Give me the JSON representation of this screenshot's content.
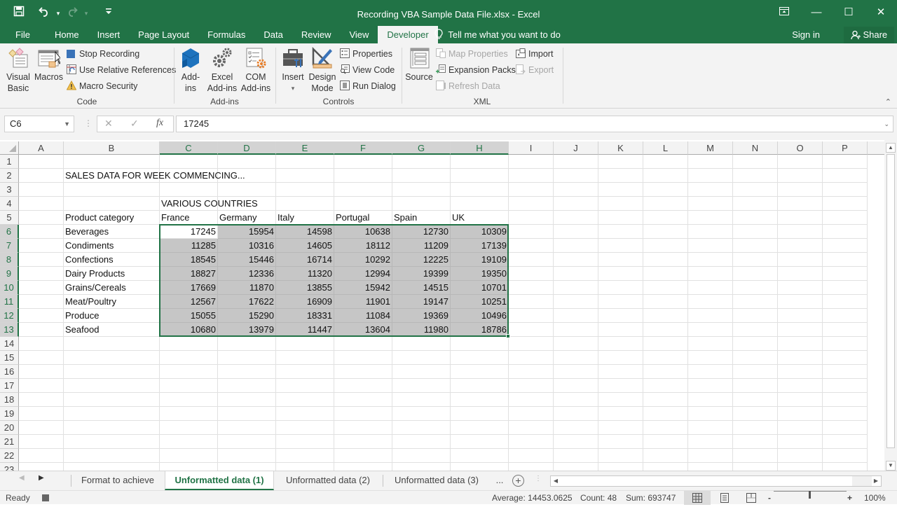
{
  "window": {
    "title": "Recording VBA Sample Data File.xlsx - Excel",
    "controls": {
      "ribbon_display": "⧉",
      "minimize": "—",
      "maximize": "☐",
      "close": "✕"
    }
  },
  "qat": {
    "save": "🖫",
    "undo": "↶",
    "undo_dd": "▾",
    "redo": "↷",
    "redo_dd": "▾",
    "customize": "⩡"
  },
  "ribbon_tabs": [
    {
      "label": "File"
    },
    {
      "label": "Home"
    },
    {
      "label": "Insert"
    },
    {
      "label": "Page Layout"
    },
    {
      "label": "Formulas"
    },
    {
      "label": "Data"
    },
    {
      "label": "Review"
    },
    {
      "label": "View"
    },
    {
      "label": "Developer",
      "active": true
    }
  ],
  "tell_me": {
    "icon": "lightbulb-icon",
    "label": "Tell me what you want to do"
  },
  "account": {
    "sign_in": "Sign in",
    "share": "Share"
  },
  "ribbon": {
    "code": {
      "label": "Code",
      "visual_basic": "Visual Basic",
      "visual_basic_l1": "Visual",
      "visual_basic_l2": "Basic",
      "macros": "Macros",
      "stop_recording": "Stop Recording",
      "use_relative_references": "Use Relative References",
      "macro_security": "Macro Security"
    },
    "addins": {
      "label": "Add-ins",
      "addins_l1": "Add-",
      "addins_l2": "ins",
      "excel_l1": "Excel",
      "excel_l2": "Add-ins",
      "com_l1": "COM",
      "com_l2": "Add-ins"
    },
    "controls": {
      "label": "Controls",
      "insert": "Insert",
      "insert_dd": "▾",
      "design_l1": "Design",
      "design_l2": "Mode",
      "properties": "Properties",
      "view_code": "View Code",
      "run_dialog": "Run Dialog"
    },
    "xml": {
      "label": "XML",
      "source": "Source",
      "map_properties": "Map Properties",
      "expansion_packs": "Expansion Packs",
      "refresh_data": "Refresh Data",
      "import": "Import",
      "export": "Export"
    },
    "collapse": "⌃"
  },
  "formula_bar": {
    "name_box": "C6",
    "cancel": "✕",
    "enter": "✓",
    "fx": "fx",
    "value": "17245"
  },
  "sheet": {
    "columns": [
      "A",
      "B",
      "C",
      "D",
      "E",
      "F",
      "G",
      "H",
      "I",
      "J",
      "K",
      "L",
      "M",
      "N",
      "O",
      "P"
    ],
    "rows": [
      "1",
      "2",
      "3",
      "4",
      "5",
      "6",
      "7",
      "8",
      "9",
      "10",
      "11",
      "12",
      "13",
      "14",
      "15",
      "16",
      "17",
      "18",
      "19",
      "20",
      "21",
      "22",
      "23"
    ],
    "title": "SALES DATA FOR WEEK COMMENCING...",
    "subtitle": "VARIOUS COUNTRIES",
    "category_header": "Product category",
    "countries": [
      "France",
      "Germany",
      "Italy",
      "Portugal",
      "Spain",
      "UK"
    ],
    "categories": [
      "Beverages",
      "Condiments",
      "Confections",
      "Dairy Products",
      "Grains/Cereals",
      "Meat/Poultry",
      "Produce",
      "Seafood"
    ],
    "values": [
      [
        17245,
        15954,
        14598,
        10638,
        12730,
        10309
      ],
      [
        11285,
        10316,
        14605,
        18112,
        11209,
        17139
      ],
      [
        18545,
        15446,
        16714,
        10292,
        12225,
        19109
      ],
      [
        18827,
        12336,
        11320,
        12994,
        19399,
        19350
      ],
      [
        17669,
        11870,
        13855,
        15942,
        14515,
        10701
      ],
      [
        12567,
        17622,
        16909,
        11901,
        19147,
        10251
      ],
      [
        15055,
        15290,
        18331,
        11084,
        19369,
        10496
      ],
      [
        10680,
        13979,
        11447,
        13604,
        11980,
        18786
      ]
    ],
    "active_cell": "C6",
    "selection": "C6:H13"
  },
  "sheet_tabs": [
    {
      "label": "Format to achieve"
    },
    {
      "label": "Unformatted data (1)",
      "active": true
    },
    {
      "label": "Unformatted data (2)"
    },
    {
      "label": "Unformatted data (3)"
    }
  ],
  "sheet_tab_more": "...",
  "sheet_tab_add": "+",
  "status_bar": {
    "mode": "Ready",
    "average": "Average: 14453.0625",
    "count": "Count: 48",
    "sum": "Sum: 693747",
    "zoom": "100%",
    "zoom_out": "-",
    "zoom_in": "+"
  },
  "colors": {
    "accent": "#217346",
    "selection_fill": "#c6c6c6",
    "ribbon_bg": "#f3f3f3"
  }
}
